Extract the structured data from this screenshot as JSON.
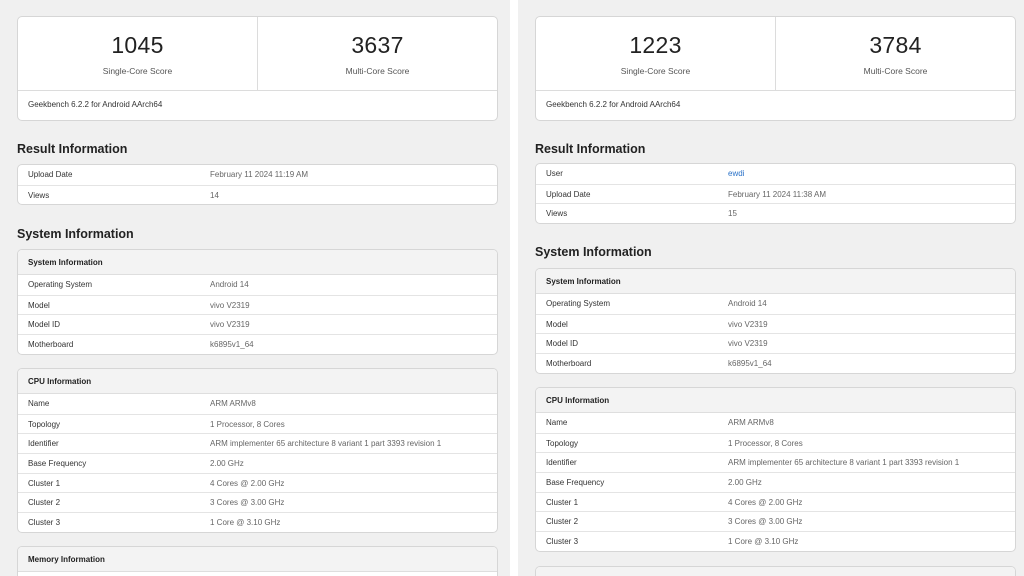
{
  "left": {
    "scores": {
      "single": "1045",
      "single_label": "Single-Core Score",
      "multi": "3637",
      "multi_label": "Multi-Core Score",
      "version": "Geekbench 6.2.2 for Android AArch64"
    },
    "result_title": "Result Information",
    "result_rows": [
      {
        "k": "Upload Date",
        "v": "February 11 2024 11:19 AM"
      },
      {
        "k": "Views",
        "v": "14"
      }
    ],
    "system_title": "System Information",
    "system_header": "System Information",
    "system_rows": [
      {
        "k": "Operating System",
        "v": "Android 14"
      },
      {
        "k": "Model",
        "v": "vivo V2319"
      },
      {
        "k": "Model ID",
        "v": "vivo V2319"
      },
      {
        "k": "Motherboard",
        "v": "k6895v1_64"
      }
    ],
    "cpu_header": "CPU Information",
    "cpu_rows": [
      {
        "k": "Name",
        "v": "ARM ARMv8"
      },
      {
        "k": "Topology",
        "v": "1 Processor, 8 Cores"
      },
      {
        "k": "Identifier",
        "v": "ARM implementer 65 architecture 8 variant 1 part 3393 revision 1"
      },
      {
        "k": "Base Frequency",
        "v": "2.00 GHz"
      },
      {
        "k": "Cluster 1",
        "v": "4 Cores @ 2.00 GHz"
      },
      {
        "k": "Cluster 2",
        "v": "3 Cores @ 3.00 GHz"
      },
      {
        "k": "Cluster 3",
        "v": "1 Core @ 3.10 GHz"
      }
    ],
    "memory_header": "Memory Information"
  },
  "right": {
    "scores": {
      "single": "1223",
      "single_label": "Single-Core Score",
      "multi": "3784",
      "multi_label": "Multi-Core Score",
      "version": "Geekbench 6.2.2 for Android AArch64"
    },
    "result_title": "Result Information",
    "result_rows": [
      {
        "k": "User",
        "v": "ewdi"
      },
      {
        "k": "Upload Date",
        "v": "February 11 2024 11:38 AM"
      },
      {
        "k": "Views",
        "v": "15"
      }
    ],
    "system_title": "System Information",
    "system_header": "System Information",
    "system_rows": [
      {
        "k": "Operating System",
        "v": "Android 14"
      },
      {
        "k": "Model",
        "v": "vivo V2319"
      },
      {
        "k": "Model ID",
        "v": "vivo V2319"
      },
      {
        "k": "Motherboard",
        "v": "k6895v1_64"
      }
    ],
    "cpu_header": "CPU Information",
    "cpu_rows": [
      {
        "k": "Name",
        "v": "ARM ARMv8"
      },
      {
        "k": "Topology",
        "v": "1 Processor, 8 Cores"
      },
      {
        "k": "Identifier",
        "v": "ARM implementer 65 architecture 8 variant 1 part 3393 revision 1"
      },
      {
        "k": "Base Frequency",
        "v": "2.00 GHz"
      },
      {
        "k": "Cluster 1",
        "v": "4 Cores @ 2.00 GHz"
      },
      {
        "k": "Cluster 2",
        "v": "3 Cores @ 3.00 GHz"
      },
      {
        "k": "Cluster 3",
        "v": "1 Core @ 3.10 GHz"
      }
    ]
  },
  "colors": {
    "link": "#2a72c8",
    "panel_bg": "#f0f0f0",
    "card_bg": "#ffffff"
  }
}
